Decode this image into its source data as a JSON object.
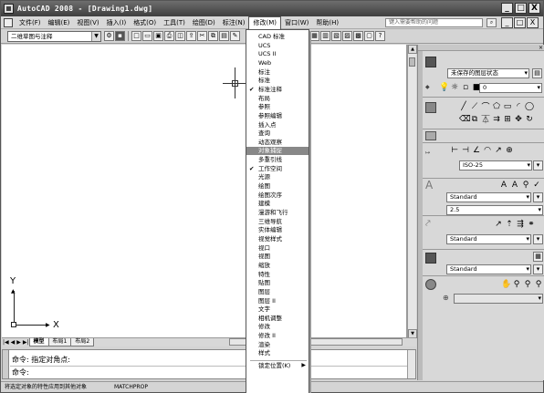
{
  "window": {
    "title": "AutoCAD 2008 - [Drawing1.dwg]",
    "buttons": [
      "_",
      "□",
      "X"
    ]
  },
  "menubar": {
    "items": [
      "文件(F)",
      "编辑(E)",
      "视图(V)",
      "插入(I)",
      "格式(O)",
      "工具(T)",
      "绘图(D)",
      "标注(N)",
      "修改(M)",
      "窗口(W)",
      "帮助(H)"
    ],
    "active_index": 8,
    "help_placeholder": "键入需要帮助的问题",
    "doc_buttons": [
      "_",
      "□",
      "X"
    ]
  },
  "toolbar": {
    "workspace": "二维草图与注释"
  },
  "popup_menu": {
    "items": [
      {
        "label": "CAD 标准",
        "checked": false
      },
      {
        "label": "UCS",
        "checked": false
      },
      {
        "label": "UCS II",
        "checked": false
      },
      {
        "label": "Web",
        "checked": false
      },
      {
        "label": "标注",
        "checked": false
      },
      {
        "label": "标准",
        "checked": false
      },
      {
        "label": "标准注释",
        "checked": true
      },
      {
        "label": "布局",
        "checked": false
      },
      {
        "label": "参照",
        "checked": false
      },
      {
        "label": "参照编辑",
        "checked": false
      },
      {
        "label": "插入点",
        "checked": false
      },
      {
        "label": "查询",
        "checked": false
      },
      {
        "label": "动态观察",
        "checked": false
      },
      {
        "label": "对象捕捉",
        "checked": false,
        "highlighted": true
      },
      {
        "label": "多重引线",
        "checked": false
      },
      {
        "label": "工作空间",
        "checked": true
      },
      {
        "label": "光源",
        "checked": false
      },
      {
        "label": "绘图",
        "checked": false
      },
      {
        "label": "绘图次序",
        "checked": false
      },
      {
        "label": "建模",
        "checked": false
      },
      {
        "label": "漫游和飞行",
        "checked": false
      },
      {
        "label": "三维导航",
        "checked": false
      },
      {
        "label": "实体编辑",
        "checked": false
      },
      {
        "label": "视觉样式",
        "checked": false
      },
      {
        "label": "视口",
        "checked": false
      },
      {
        "label": "视图",
        "checked": false
      },
      {
        "label": "缩放",
        "checked": false
      },
      {
        "label": "特性",
        "checked": false
      },
      {
        "label": "贴图",
        "checked": false
      },
      {
        "label": "图层",
        "checked": false
      },
      {
        "label": "图层 II",
        "checked": false
      },
      {
        "label": "文字",
        "checked": false
      },
      {
        "label": "相机调整",
        "checked": false
      },
      {
        "label": "修改",
        "checked": false
      },
      {
        "label": "修改 II",
        "checked": false
      },
      {
        "label": "渲染",
        "checked": false
      },
      {
        "label": "样式",
        "checked": false
      }
    ],
    "footer": "锁定位置(K)"
  },
  "tabs": {
    "items": [
      "模型",
      "布局1",
      "布局2"
    ],
    "selected": 0
  },
  "command": {
    "line1": "命令: 指定对角点:",
    "line2": "命令:"
  },
  "status": {
    "text": "将选定对象的特性应用到其他对象",
    "command_name": "MATCHPROP"
  },
  "dashboard": {
    "layer_state": "未保存的图层状态",
    "layer_current": "0",
    "dim_style": "ISO-25",
    "text_style": "Standard",
    "text_height": "2.5",
    "mleader_style": "Standard",
    "table_style": "Standard"
  },
  "icons": {
    "app": "autocad-logo-icon",
    "crosshair": "crosshair-cursor-icon",
    "ucs": "ucs-axis-icon"
  }
}
